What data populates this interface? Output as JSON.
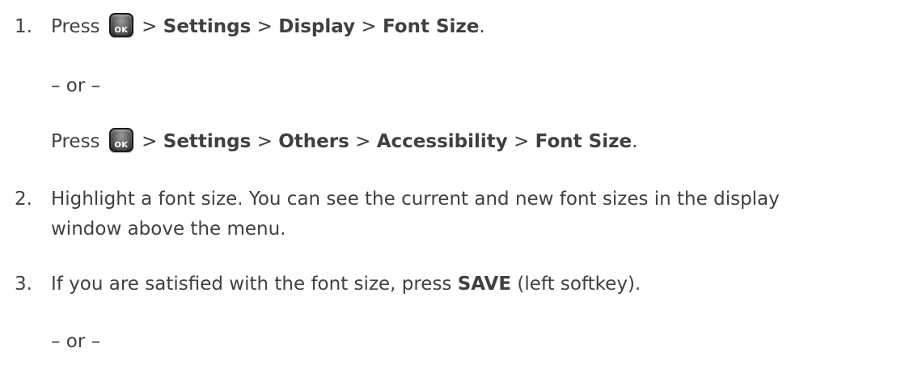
{
  "steps": {
    "step1": {
      "number": "1.",
      "press": "Press",
      "ok_key": "OK",
      "sep1": ">",
      "settings": "Settings",
      "sep2": ">",
      "display": "Display",
      "sep3": ">",
      "font_size": "Font Size",
      "end": "."
    },
    "or1": "– or –",
    "step1_alt": {
      "press": "Press",
      "ok_key": "OK",
      "sep1": ">",
      "settings": "Settings",
      "sep2": ">",
      "others": "Others",
      "sep3": ">",
      "accessibility": "Accessibility",
      "sep4": ">",
      "font_size": "Font Size",
      "end": "."
    },
    "step2": {
      "number": "2.",
      "line1": "Highlight a font size. You can see the current and new font sizes in the display",
      "line2": "window above the menu."
    },
    "step3": {
      "number": "3.",
      "before": "If you are satisfied with the font size, press",
      "save": "SAVE",
      "after": "(left softkey)."
    },
    "or2": "– or –"
  }
}
